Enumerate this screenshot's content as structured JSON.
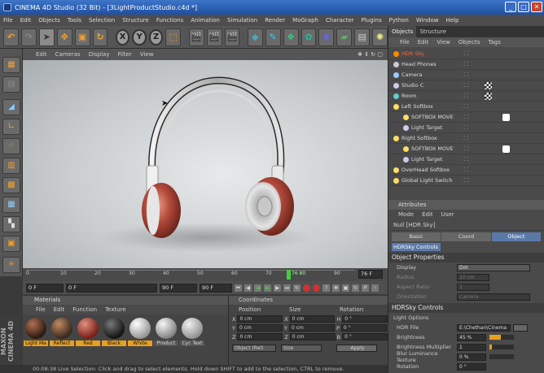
{
  "window": {
    "title": "CINEMA 4D Studio (32 Bit) - [3LightProductStudio.c4d *]",
    "min": "_",
    "max": "□",
    "close": "✕"
  },
  "menubar": [
    "File",
    "Edit",
    "Objects",
    "Tools",
    "Selection",
    "Structure",
    "Functions",
    "Animation",
    "Simulation",
    "Render",
    "MoGraph",
    "Character",
    "Plugins",
    "Python",
    "Window",
    "Help"
  ],
  "viewport_menu": [
    "Edit",
    "Cameras",
    "Display",
    "Filter",
    "View"
  ],
  "toolbar": {
    "x": "X",
    "y": "Y",
    "z": "Z"
  },
  "timeline": {
    "ticks": [
      "0",
      "10",
      "20",
      "30",
      "40",
      "50",
      "60",
      "70",
      "76 80",
      "90"
    ],
    "frame_marker": "76",
    "end_label": "76 F"
  },
  "playbar": {
    "start": "0 F",
    "preview_start": "0 F",
    "preview_end": "90 F",
    "end": "90 F"
  },
  "materials": {
    "title": "Materials",
    "menu": [
      "File",
      "Edit",
      "Function",
      "Texture"
    ],
    "items": [
      {
        "label": "Light Ma",
        "color": "#2a1a12",
        "highlight": true
      },
      {
        "label": "Reflect",
        "color": "#3a2a20",
        "highlight": true
      },
      {
        "label": "Red",
        "color": "#7a1f1a",
        "highlight": true
      },
      {
        "label": "Black",
        "color": "#151515",
        "highlight": true
      },
      {
        "label": "White",
        "color": "#d8d8d8",
        "highlight": true
      },
      {
        "label": "Product",
        "color": "#b8b8b8",
        "highlight": false
      },
      {
        "label": "Cyc Text",
        "color": "#c4c4c4",
        "highlight": false
      }
    ]
  },
  "coordinates": {
    "title": "Coordinates",
    "columns": [
      "Position",
      "Size",
      "Rotation"
    ],
    "rows": [
      {
        "axis": "X",
        "pos": "0 cm",
        "size_axis": "X",
        "size": "0 cm",
        "rot_axis": "H",
        "rot": "0 °"
      },
      {
        "axis": "Y",
        "pos": "0 cm",
        "size_axis": "Y",
        "size": "0 cm",
        "rot_axis": "P",
        "rot": "0 °"
      },
      {
        "axis": "Z",
        "pos": "0 cm",
        "size_axis": "Z",
        "size": "0 cm",
        "rot_axis": "B",
        "rot": "0 °"
      }
    ],
    "mode": "Object (Rel)",
    "size_mode": "Size",
    "apply": "Apply"
  },
  "status": "00:08:38  Live Selection: Click and drag to select elements. Hold down SHIFT to add to the selection, CTRL to remove.",
  "maxon": "MAXON CINEMA 4D",
  "object_manager": {
    "tabs": [
      "Objects",
      "Structure"
    ],
    "menu": [
      "File",
      "Edit",
      "View",
      "Objects",
      "Tags"
    ],
    "items": [
      {
        "name": "HDR Sky",
        "indent": 0,
        "hl": true
      },
      {
        "name": "Head Phones",
        "indent": 0,
        "hl": false
      },
      {
        "name": "Camera",
        "indent": 0,
        "hl": false
      },
      {
        "name": "Studio C",
        "indent": 0,
        "hl": false
      },
      {
        "name": "Room",
        "indent": 0,
        "hl": false
      },
      {
        "name": "Left Softbox",
        "indent": 0,
        "hl": false
      },
      {
        "name": "SOFTBOX MOVE",
        "indent": 1,
        "hl": false
      },
      {
        "name": "Light Target",
        "indent": 1,
        "hl": false
      },
      {
        "name": "Right Softbox",
        "indent": 0,
        "hl": false
      },
      {
        "name": "SOFTBOX MOVE",
        "indent": 1,
        "hl": false
      },
      {
        "name": "Light Target",
        "indent": 1,
        "hl": false
      },
      {
        "name": "OverHead Softbox",
        "indent": 0,
        "hl": false
      },
      {
        "name": "Global Light Switch",
        "indent": 0,
        "hl": false
      }
    ]
  },
  "attributes": {
    "title": "Attributes",
    "menu": [
      "Mode",
      "Edit",
      "User"
    ],
    "object_title": "Null [HDR Sky]",
    "tabs": [
      "Basic",
      "Coord",
      "Object"
    ],
    "active_tab": "Object",
    "selector": "HDRSky Controls",
    "section1": "Object Properties",
    "props1": [
      {
        "label": "Display",
        "value": "Dot",
        "dim": false
      },
      {
        "label": "Radius",
        "value": "10 cm",
        "dim": true
      },
      {
        "label": "Aspect Ratio",
        "value": "1",
        "dim": true
      },
      {
        "label": "Orientation",
        "value": "Camera",
        "dim": true
      }
    ],
    "section2": "HDRSky Controls",
    "subsection": "Light Options",
    "props2": [
      {
        "label": "HDR File",
        "value": "E:\\Chethan\\Cinema"
      },
      {
        "label": "Brightness",
        "value": "45 %",
        "fill": 0.45
      },
      {
        "label": "Brightness Multiplier",
        "value": "1",
        "fill": 0.1
      },
      {
        "label": "Blur Luminance Texture",
        "value": "0 %",
        "fill": 0
      },
      {
        "label": "Rotation",
        "value": "0 °",
        "fill": 0
      }
    ]
  }
}
